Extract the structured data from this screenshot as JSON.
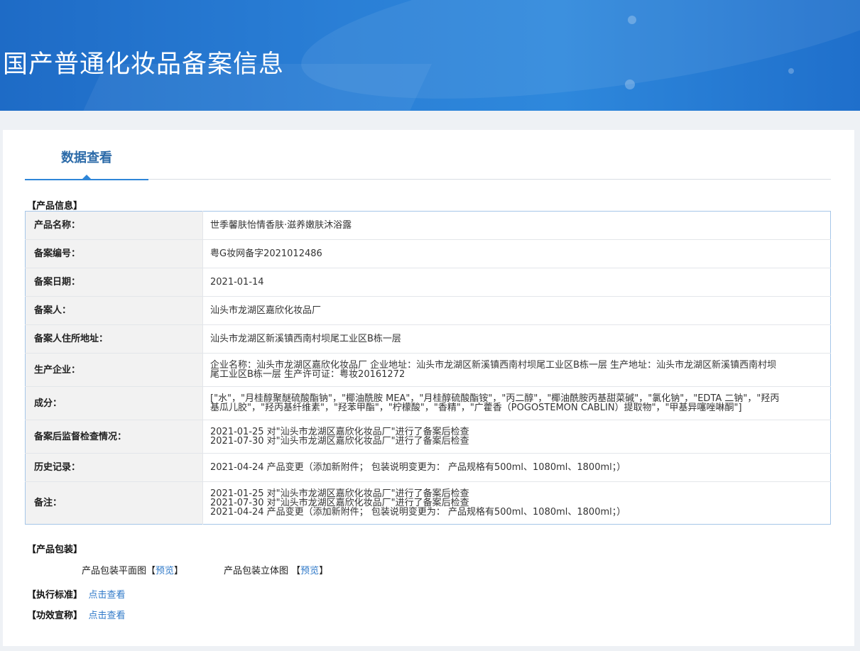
{
  "header": {
    "title": "国产普通化妆品备案信息"
  },
  "tab": {
    "label": "数据查看"
  },
  "sections": {
    "product_info": "【产品信息】",
    "packaging": "【产品包装】",
    "standard": "【执行标准】",
    "efficacy": "【功效宣称】"
  },
  "rows": [
    {
      "label": "产品名称：",
      "lines": [
        "世季馨肤怡情香肤·滋养嫩肤沐浴露"
      ]
    },
    {
      "label": "备案编号：",
      "lines": [
        "粤G妆网备字2021012486"
      ]
    },
    {
      "label": "备案日期：",
      "lines": [
        "2021-01-14"
      ]
    },
    {
      "label": "备案人：",
      "lines": [
        "汕头市龙湖区嘉欣化妆品厂"
      ]
    },
    {
      "label": "备案人住所地址：",
      "lines": [
        "汕头市龙湖区新溪镇西南村坝尾工业区B栋一层"
      ]
    },
    {
      "label": "生产企业：",
      "lines": [
        "企业名称：汕头市龙湖区嘉欣化妆品厂 企业地址：汕头市龙湖区新溪镇西南村坝尾工业区B栋一层 生产地址：汕头市龙湖区新溪镇西南村坝",
        "尾工业区B栋一层 生产许可证：粤妆20161272"
      ]
    },
    {
      "label": "成分：",
      "lines": [
        "[\"水\"，\"月桂醇聚醚硫酸酯钠\"，\"椰油酰胺 MEA\"，\"月桂醇硫酸酯铵\"，\"丙二醇\"，\"椰油酰胺丙基甜菜碱\"，\"氯化钠\"，\"EDTA 二钠\"，\"羟丙",
        "基瓜儿胶\"，\"羟丙基纤维素\"，\"羟苯甲酯\"，\"柠檬酸\"，\"香精\"，\"广藿香（POGOSTEMON CABLIN）提取物\"，\"甲基异噻唑啉酮\"]"
      ]
    },
    {
      "label": "备案后监督检查情况：",
      "lines": [
        "2021-01-25 对\"汕头市龙湖区嘉欣化妆品厂\"进行了备案后检查",
        "2021-07-30 对\"汕头市龙湖区嘉欣化妆品厂\"进行了备案后检查"
      ]
    },
    {
      "label": "历史记录：",
      "lines": [
        "2021-04-24 产品变更（添加新附件； 包装说明变更为： 产品规格有500ml、1080ml、1800ml；）"
      ]
    },
    {
      "label": "备注：",
      "lines": [
        "2021-01-25 对\"汕头市龙湖区嘉欣化妆品厂\"进行了备案后检查",
        "2021-07-30 对\"汕头市龙湖区嘉欣化妆品厂\"进行了备案后检查",
        "2021-04-24 产品变更（添加新附件； 包装说明变更为： 产品规格有500ml、1080ml、1800ml；）"
      ]
    }
  ],
  "packaging": {
    "flat_label": "产品包装平面图",
    "stereo_label": "产品包装立体图",
    "open_bracket": "【",
    "close_bracket": "】",
    "preview": "预览"
  },
  "links": {
    "view": "点击查看"
  }
}
